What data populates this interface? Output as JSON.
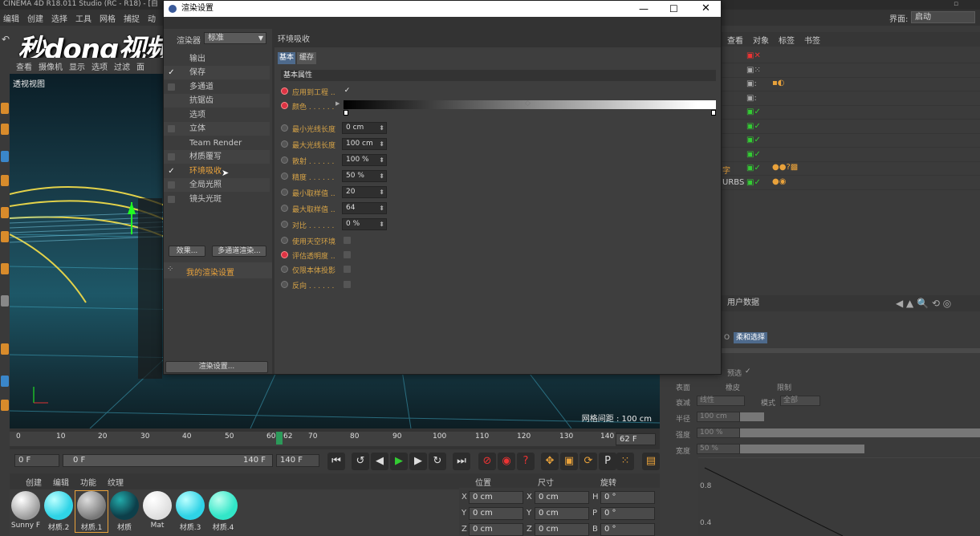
{
  "app": {
    "title": "CINEMA 4D R18.011 Studio (RC - R18) - [自",
    "menus": [
      "编辑",
      "创建",
      "选择",
      "工具",
      "网格",
      "捕捉",
      "动"
    ],
    "interface_label": "界面:",
    "interface_value": "启动",
    "watermark": "秒dong视频"
  },
  "viewport": {
    "menus": [
      "查看",
      "摄像机",
      "显示",
      "选项",
      "过滤",
      "面"
    ],
    "label": "透视视图",
    "grid_distance": "网格间距 : 100 cm"
  },
  "timeline": {
    "ticks": [
      "0",
      "10",
      "20",
      "30",
      "40",
      "50",
      "60",
      "62",
      "70",
      "80",
      "90",
      "100",
      "110",
      "120",
      "130",
      "140"
    ],
    "current_frame": "62 F",
    "start_field": "0 F",
    "range_start": "0 F",
    "range_end": "140 F",
    "end_field": "140 F"
  },
  "materials": {
    "menus": [
      "创建",
      "编辑",
      "功能",
      "纹理"
    ],
    "items": [
      {
        "name": "Sunny F",
        "color": "#d6d6d6"
      },
      {
        "name": "材质.2",
        "color": "#2fd3e6"
      },
      {
        "name": "材质.1",
        "color": "#9a9a9a"
      },
      {
        "name": "材质",
        "color": "#0d3f4a"
      },
      {
        "name": "Mat",
        "color": "#f2f2f2"
      },
      {
        "name": "材质.3",
        "color": "#2fd3e6"
      },
      {
        "name": "材质.4",
        "color": "#32e6c8"
      }
    ]
  },
  "coordinates": {
    "headers": [
      "位置",
      "尺寸",
      "旋转"
    ],
    "rows": [
      {
        "a": "X",
        "av": "0 cm",
        "b": "X",
        "bv": "0 cm",
        "c": "H",
        "cv": "0 °"
      },
      {
        "a": "Y",
        "av": "0 cm",
        "b": "Y",
        "bv": "0 cm",
        "c": "P",
        "cv": "0 °"
      },
      {
        "a": "Z",
        "av": "0 cm",
        "b": "Z",
        "bv": "0 cm",
        "c": "B",
        "cv": "0 °"
      }
    ]
  },
  "object_manager": {
    "tabs": [
      "查看",
      "对象",
      "标签",
      "书签"
    ],
    "partial_labels": [
      "字",
      "URBS"
    ]
  },
  "attribute_manager": {
    "header": "用户数据",
    "tab_partial": "O",
    "tab_soft": "柔和选择",
    "preview_label": "预选",
    "row1": [
      "表面",
      "橡皮",
      "限制"
    ],
    "falloff_label": "衰减",
    "falloff_value": "线性",
    "mode_label": "模式",
    "mode_value": "全部",
    "radius_label": "半径",
    "radius_value": "100 cm",
    "strength_label": "强度",
    "strength_value": "100 %",
    "width_label": "宽度",
    "width_value": "50 %",
    "graph_ticks": [
      "0.8",
      "0.4"
    ]
  },
  "dialog": {
    "title": "渲染设置",
    "renderer_label": "渲染器",
    "renderer_value": "标准",
    "tree": [
      {
        "label": "输出",
        "check": "",
        "stripe": false
      },
      {
        "label": "保存",
        "check": "✓",
        "stripe": true
      },
      {
        "label": "多通道",
        "check": "box",
        "stripe": false
      },
      {
        "label": "抗锯齿",
        "check": "",
        "stripe": true
      },
      {
        "label": "选项",
        "check": "",
        "stripe": false
      },
      {
        "label": "立体",
        "check": "box",
        "stripe": true
      },
      {
        "label": "Team Render",
        "check": "",
        "stripe": false
      },
      {
        "label": "材质覆写",
        "check": "box",
        "stripe": true
      },
      {
        "label": "环境吸收",
        "check": "✓",
        "stripe": false,
        "active": true
      },
      {
        "label": "全局光照",
        "check": "box",
        "stripe": true
      },
      {
        "label": "镜头光斑",
        "check": "box",
        "stripe": false
      }
    ],
    "effects_btn": "效果...",
    "multipass_btn": "多通道渲染...",
    "my_settings": "我的渲染设置",
    "render_settings_btn": "渲染设置...",
    "section_title": "环境吸收",
    "tab_basic": "基本",
    "tab_cache": "缓存",
    "group_title": "基本属性",
    "params": [
      {
        "label": "应用到工程 ..",
        "type": "check",
        "value": "✓",
        "radio": "on"
      },
      {
        "label": "颜色 . . . . . .",
        "type": "gradient",
        "value": "",
        "radio": "on"
      },
      {
        "label": "最小光线长度",
        "type": "field",
        "value": "0 cm",
        "radio": "off"
      },
      {
        "label": "最大光线长度",
        "type": "field",
        "value": "100 cm",
        "radio": "off"
      },
      {
        "label": "散射 . . . . . .",
        "type": "field",
        "value": "100 %",
        "radio": "off"
      },
      {
        "label": "精度 . . . . . .",
        "type": "field",
        "value": "50 %",
        "radio": "off"
      },
      {
        "label": "最小取样值 ..",
        "type": "field",
        "value": "20",
        "radio": "off"
      },
      {
        "label": "最大取样值 ..",
        "type": "field",
        "value": "64",
        "radio": "off"
      },
      {
        "label": "对比 . . . . . .",
        "type": "field",
        "value": "0 %",
        "radio": "off"
      },
      {
        "label": "使用天空环境",
        "type": "check",
        "value": "",
        "radio": "off"
      },
      {
        "label": "评估透明度 ..",
        "type": "check",
        "value": "",
        "radio": "on"
      },
      {
        "label": "仅限本体投影",
        "type": "check",
        "value": "",
        "radio": "off"
      },
      {
        "label": "反向 . . . . . .",
        "type": "check",
        "value": "",
        "radio": "off"
      }
    ]
  }
}
